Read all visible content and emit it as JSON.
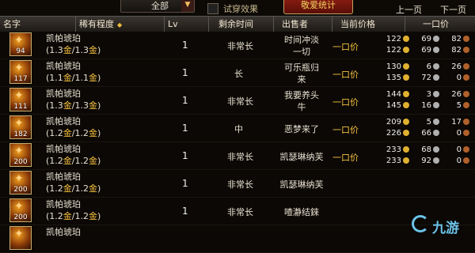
{
  "toolbar": {
    "filter_value": "全部",
    "tryon_label": "试穿效果",
    "red_button_label": "敬爱统计",
    "prev_page": "上一页",
    "next_page": "下一页"
  },
  "headers": {
    "name": "名字",
    "rarity": "稀有程度",
    "lv": "Lv",
    "time_left": "剩余时间",
    "seller": "出售者",
    "current_price": "当前价格",
    "buyout": "一口价"
  },
  "currency_colors": {
    "gold": "#e0b030",
    "silver": "#b0b0b0",
    "copper": "#b0602a"
  },
  "rows": [
    {
      "icon_level": "94",
      "item_name": "凯帕琥珀",
      "ratio_a": "1.3",
      "ratio_b": "1.3",
      "unit": "金",
      "lv": "1",
      "time": "非常长",
      "seller_1": "时间冲淡",
      "seller_2": "一切",
      "bid_label": "一口价",
      "cur_gold": "122",
      "cur_silver": "69",
      "cur_copper": "82",
      "buy_gold": "122",
      "buy_silver": "69",
      "buy_copper": "82"
    },
    {
      "icon_level": "117",
      "item_name": "凯帕琥珀",
      "ratio_a": "1.1",
      "ratio_b": "1.1",
      "unit": "金",
      "lv": "1",
      "time": "长",
      "seller_1": "可乐瓶归",
      "seller_2": "来",
      "bid_label": "一口价",
      "cur_gold": "130",
      "cur_silver": "6",
      "cur_copper": "26",
      "buy_gold": "135",
      "buy_silver": "72",
      "buy_copper": "0"
    },
    {
      "icon_level": "111",
      "item_name": "凯帕琥珀",
      "ratio_a": "1.3",
      "ratio_b": "1.3",
      "unit": "金",
      "lv": "1",
      "time": "非常长",
      "seller_1": "我要养头",
      "seller_2": "牛",
      "bid_label": "一口价",
      "cur_gold": "144",
      "cur_silver": "3",
      "cur_copper": "26",
      "buy_gold": "145",
      "buy_silver": "16",
      "buy_copper": "5"
    },
    {
      "icon_level": "182",
      "item_name": "凯帕琥珀",
      "ratio_a": "1.2",
      "ratio_b": "1.2",
      "unit": "金",
      "lv": "1",
      "time": "中",
      "seller_1": "恶梦来了",
      "seller_2": "",
      "bid_label": "一口价",
      "cur_gold": "209",
      "cur_silver": "5",
      "cur_copper": "17",
      "buy_gold": "226",
      "buy_silver": "66",
      "buy_copper": "0"
    },
    {
      "icon_level": "200",
      "item_name": "凯帕琥珀",
      "ratio_a": "1.2",
      "ratio_b": "1.2",
      "unit": "金",
      "lv": "1",
      "time": "非常长",
      "seller_1": "凯瑟琳纳芙",
      "seller_2": "",
      "bid_label": "一口价",
      "cur_gold": "233",
      "cur_silver": "68",
      "cur_copper": "0",
      "buy_gold": "233",
      "buy_silver": "92",
      "buy_copper": "0"
    },
    {
      "icon_level": "200",
      "item_name": "凯帕琥珀",
      "ratio_a": "1.2",
      "ratio_b": "1.2",
      "unit": "金",
      "lv": "1",
      "time": "非常长",
      "seller_1": "凯瑟琳纳芙",
      "seller_2": "",
      "bid_label": "",
      "cur_gold": "",
      "cur_silver": "",
      "cur_copper": "",
      "buy_gold": "",
      "buy_silver": "",
      "buy_copper": ""
    },
    {
      "icon_level": "200",
      "item_name": "凯帕琥珀",
      "ratio_a": "1.2",
      "ratio_b": "1.2",
      "unit": "金",
      "lv": "1",
      "time": "非常长",
      "seller_1": "喳瀞结錸",
      "seller_2": "",
      "bid_label": "",
      "cur_gold": "",
      "cur_silver": "",
      "cur_copper": "",
      "buy_gold": "",
      "buy_silver": "",
      "buy_copper": ""
    },
    {
      "icon_level": "",
      "item_name": "凯帕琥珀",
      "ratio_a": "",
      "ratio_b": "",
      "unit": "",
      "lv": "",
      "time": "",
      "seller_1": "",
      "seller_2": "",
      "bid_label": "",
      "cur_gold": "",
      "cur_silver": "",
      "cur_copper": "",
      "buy_gold": "",
      "buy_silver": "",
      "buy_copper": ""
    }
  ],
  "watermark": {
    "text": "九游"
  }
}
